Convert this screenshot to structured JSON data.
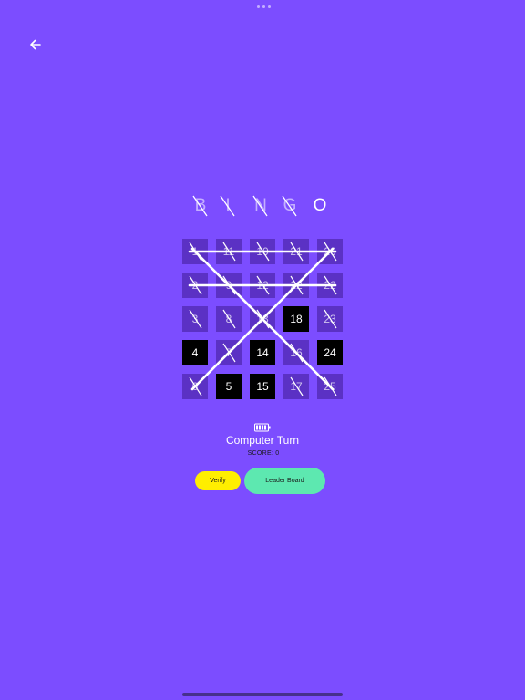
{
  "header": {
    "back_icon": "arrow-left-icon"
  },
  "bingo_letters": [
    {
      "letter": "B",
      "crossed": true
    },
    {
      "letter": "I",
      "crossed": true
    },
    {
      "letter": "N",
      "crossed": true
    },
    {
      "letter": "G",
      "crossed": true
    },
    {
      "letter": "O",
      "crossed": false
    }
  ],
  "board": {
    "rows": [
      [
        {
          "value": "1",
          "state": "crossed"
        },
        {
          "value": "11",
          "state": "crossed"
        },
        {
          "value": "10",
          "state": "crossed"
        },
        {
          "value": "21",
          "state": "crossed"
        },
        {
          "value": "20",
          "state": "crossed"
        }
      ],
      [
        {
          "value": "2",
          "state": "crossed"
        },
        {
          "value": "9",
          "state": "crossed"
        },
        {
          "value": "12",
          "state": "crossed"
        },
        {
          "value": "22",
          "state": "crossed"
        },
        {
          "value": "22",
          "state": "crossed"
        }
      ],
      [
        {
          "value": "3",
          "state": "crossed"
        },
        {
          "value": "8",
          "state": "crossed"
        },
        {
          "value": "13",
          "state": "crossed"
        },
        {
          "value": "18",
          "state": "open"
        },
        {
          "value": "23",
          "state": "crossed"
        }
      ],
      [
        {
          "value": "4",
          "state": "open"
        },
        {
          "value": "7",
          "state": "crossed"
        },
        {
          "value": "14",
          "state": "open"
        },
        {
          "value": "16",
          "state": "crossed"
        },
        {
          "value": "24",
          "state": "open"
        }
      ],
      [
        {
          "value": "6",
          "state": "crossed"
        },
        {
          "value": "5",
          "state": "open"
        },
        {
          "value": "15",
          "state": "open"
        },
        {
          "value": "17",
          "state": "crossed"
        },
        {
          "value": "25",
          "state": "crossed"
        }
      ]
    ],
    "completed_lines": [
      {
        "type": "row",
        "index": 0
      },
      {
        "type": "row",
        "index": 1
      },
      {
        "type": "diagonal",
        "index": 0
      },
      {
        "type": "diagonal",
        "index": 1
      }
    ]
  },
  "status": {
    "turn_icon": "battery-icon",
    "turn_text": "Computer Turn",
    "score_label": "SCORE:",
    "score_value": "0"
  },
  "actions": {
    "verify_label": "Verify",
    "leaderboard_label": "Leader Board"
  },
  "colors": {
    "background": "#7c4dff",
    "cell": "#5b31c4",
    "cell_open": "#000000",
    "verify": "#ffee00",
    "leaderboard": "#5de8b0"
  }
}
